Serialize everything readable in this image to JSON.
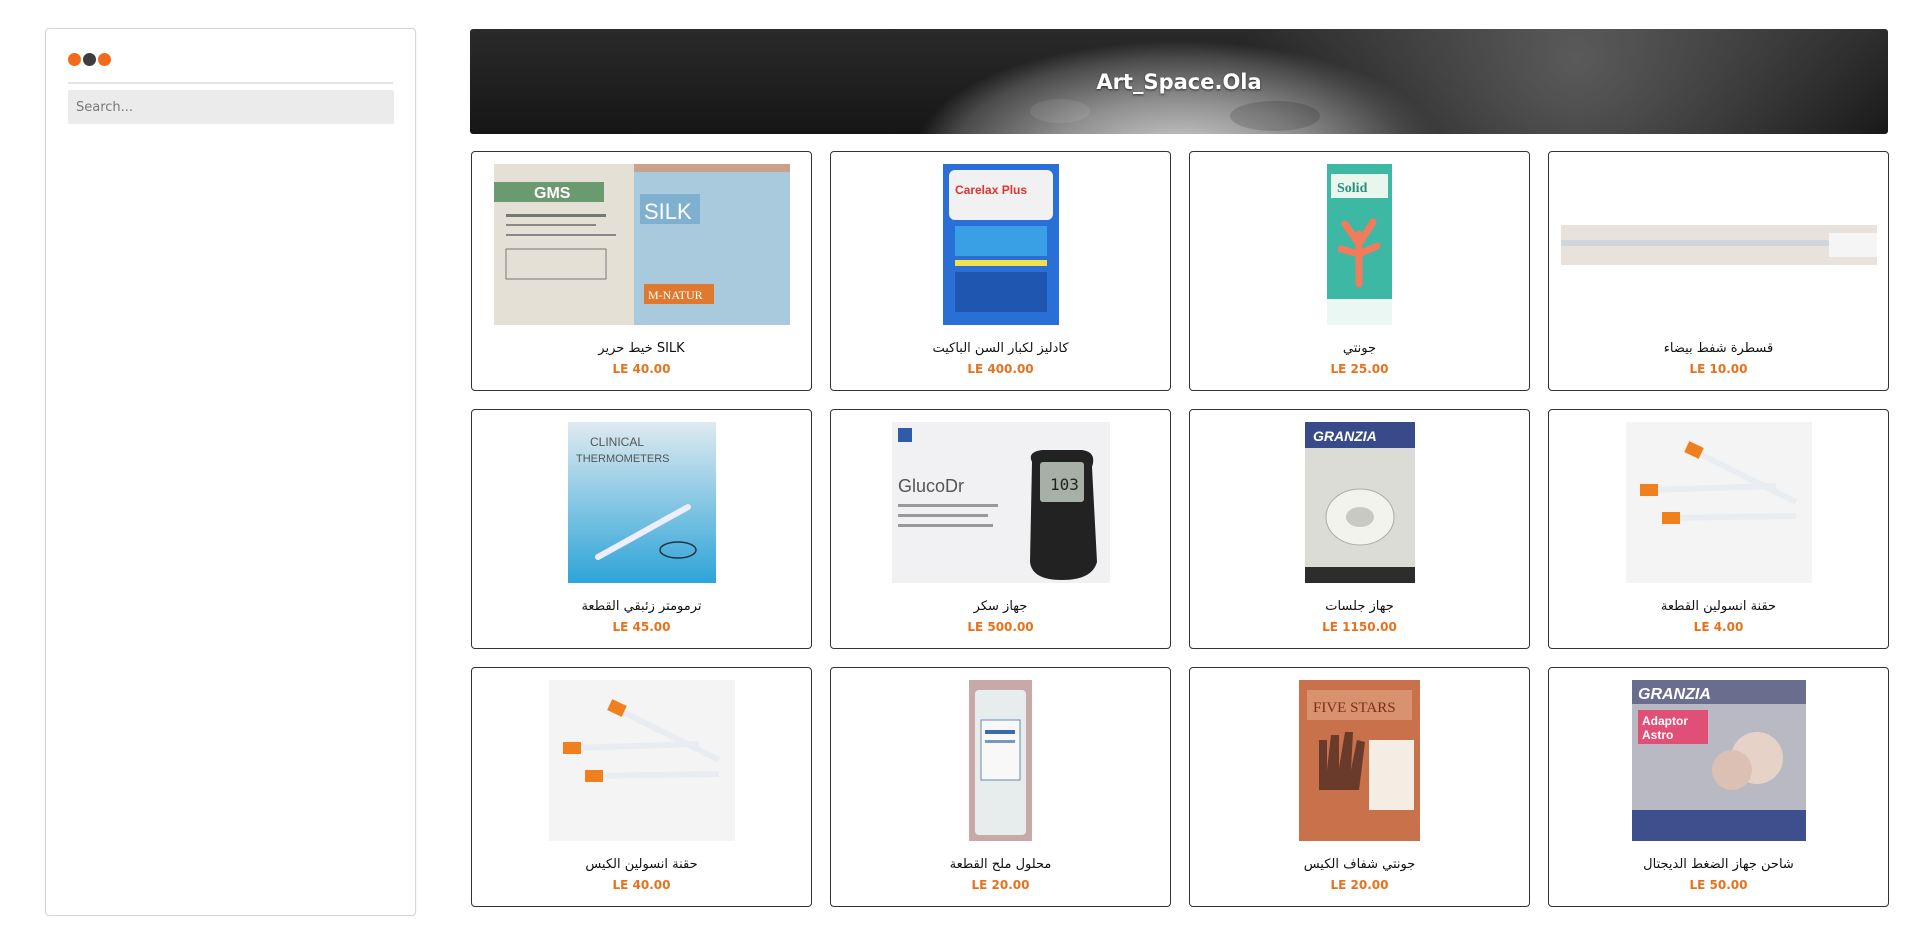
{
  "sidebar": {
    "dot_colors": [
      "#f26b1d",
      "#3d3d3d",
      "#f26b1d"
    ],
    "search": {
      "placeholder": "Search...",
      "value": ""
    }
  },
  "header": {
    "title": "Art_Space.Ola"
  },
  "colors": {
    "price": "#e8711c",
    "accent": "#f26b1d"
  },
  "products": [
    {
      "name": "خيط حرير SILK",
      "price": "LE 40.00",
      "icon": "suture-boxes-image"
    },
    {
      "name": "كادليز لكبار السن الباكيت",
      "price": "LE 400.00",
      "icon": "adult-diaper-pack-image"
    },
    {
      "name": "جونتي",
      "price": "LE 25.00",
      "icon": "gloves-box-image"
    },
    {
      "name": "قسطرة شفط بيضاء",
      "price": "LE 10.00",
      "icon": "suction-catheter-image"
    },
    {
      "name": "ترمومتر زئبقي القطعة",
      "price": "LE 45.00",
      "icon": "clinical-thermometer-image"
    },
    {
      "name": "جهاز سكر",
      "price": "LE 500.00",
      "icon": "glucose-meter-image"
    },
    {
      "name": "جهاز جلسات",
      "price": "LE 1150.00",
      "icon": "nebulizer-box-image"
    },
    {
      "name": "حقنة انسولين القطعة",
      "price": "LE 4.00",
      "icon": "insulin-syringes-image"
    },
    {
      "name": "حقنة انسولين الكيس",
      "price": "LE 40.00",
      "icon": "insulin-syringes-bag-image"
    },
    {
      "name": "محلول ملح القطعة",
      "price": "LE 20.00",
      "icon": "saline-bag-image"
    },
    {
      "name": "جونتي شفاف الكيس",
      "price": "LE 20.00",
      "icon": "exam-gloves-pack-image"
    },
    {
      "name": "شاحن جهاز الضغط الديجتال",
      "price": "LE 50.00",
      "icon": "bp-adaptor-box-image"
    }
  ]
}
